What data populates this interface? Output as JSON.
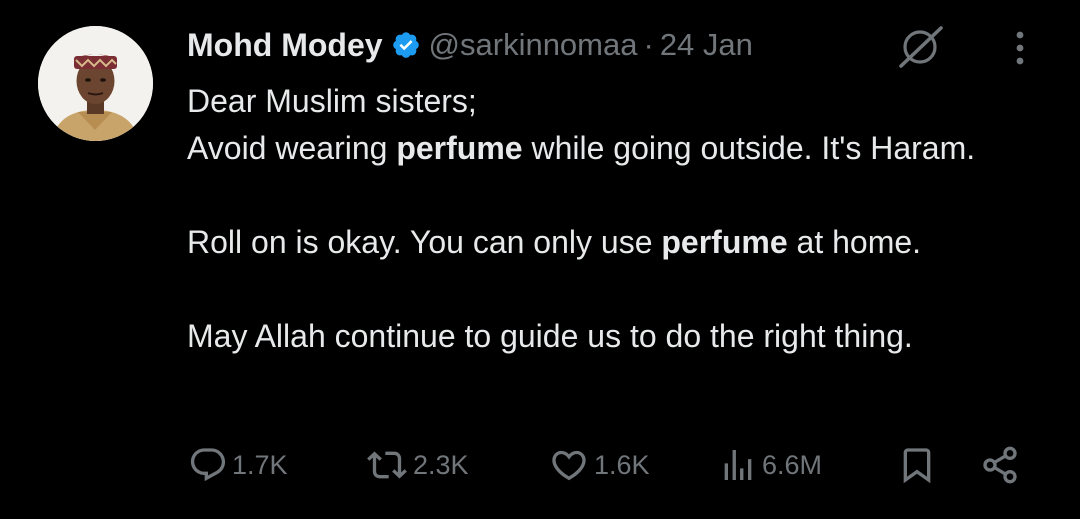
{
  "tweet": {
    "author": {
      "display_name": "Mohd Modey",
      "handle": "@sarkinnomaa",
      "verified": true,
      "verified_color": "#1d9bf0"
    },
    "separator": "·",
    "time": "24 Jan",
    "text": {
      "line1": "Dear Muslim sisters;",
      "line2_pre": "Avoid wearing ",
      "line2_bold": "perfume",
      "line2_post": " while going outside. It's Haram.",
      "line3_pre": "Roll on is okay. You can only use ",
      "line3_bold": "perfume",
      "line3_post": " at home.",
      "line4": "May Allah continue to guide us to do the right thing."
    },
    "stats": {
      "replies": "1.7K",
      "reposts": "2.3K",
      "likes": "1.6K",
      "views": "6.6M"
    },
    "icons": {
      "reply": "reply-icon",
      "repost": "repost-icon",
      "like": "heart-icon",
      "views": "views-chart-icon",
      "bookmark": "bookmark-icon",
      "share": "share-icon",
      "grok": "grok-icon",
      "more": "more-icon"
    },
    "colors": {
      "background": "#000000",
      "text": "#e7e9ea",
      "muted": "#71767b"
    }
  }
}
